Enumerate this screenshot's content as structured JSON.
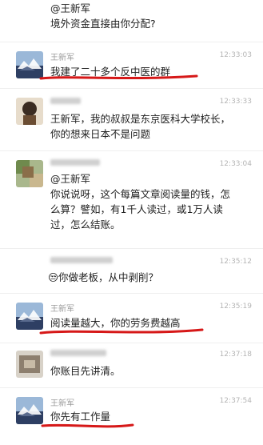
{
  "messages": [
    {
      "sender": "",
      "time": "",
      "lines": [
        "@王新军",
        "境外资金直接由你分配?"
      ]
    },
    {
      "sender": "王新军",
      "time": "12:33:03",
      "lines": [
        "我建了二十多个反中医的群"
      ]
    },
    {
      "sender": "",
      "time": "12:33:33",
      "lines": [
        "王新军，我的叔叔是东京医科大学校长，",
        "你的想来日本不是问题"
      ]
    },
    {
      "sender": "",
      "time": "12:33:04",
      "lines": [
        "@王新军",
        "你说说呀，这个每篇文章阅读量的钱，怎",
        "么算？譬如，有1千人读过，或1万人读",
        "过，怎么结账。"
      ]
    },
    {
      "sender": "",
      "time": "12:35:12",
      "lines": [
        "😒你做老板，从中剥削？"
      ]
    },
    {
      "sender": "王新军",
      "time": "12:35:19",
      "lines": [
        "阅读量越大，你的劳务费越高"
      ]
    },
    {
      "sender": "",
      "time": "12:37:18",
      "lines": [
        "你账目先讲清。"
      ]
    },
    {
      "sender": "王新军",
      "time": "12:37:54",
      "lines": [
        "你先有工作量"
      ]
    }
  ]
}
